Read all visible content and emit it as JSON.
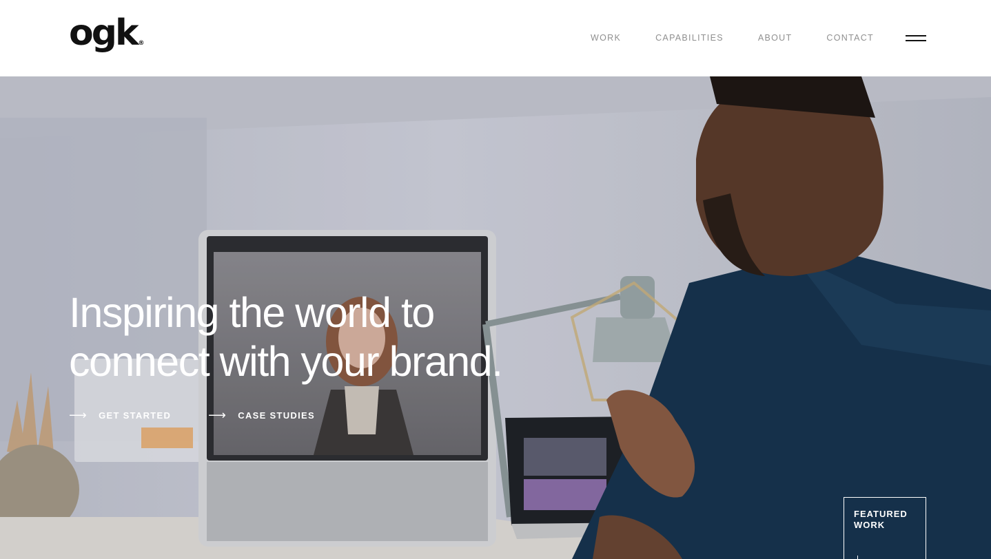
{
  "header": {
    "logo_text": "ogk",
    "logo_mark": "®",
    "nav": [
      {
        "label": "WORK"
      },
      {
        "label": "CAPABILITIES"
      },
      {
        "label": "ABOUT"
      },
      {
        "label": "CONTACT"
      }
    ],
    "menu_icon": "hamburger-icon"
  },
  "hero": {
    "title_line1": "Inspiring the world to",
    "title_line2": "connect with your brand.",
    "ctas": [
      {
        "label": "GET STARTED",
        "icon": "arrow-right-icon"
      },
      {
        "label": "CASE STUDIES",
        "icon": "arrow-right-icon"
      }
    ],
    "featured_line1": "FEATURED",
    "featured_line2": "WORK"
  },
  "colors": {
    "nav_text": "#8f8f8f",
    "logo": "#111111",
    "hero_text": "#ffffff"
  }
}
